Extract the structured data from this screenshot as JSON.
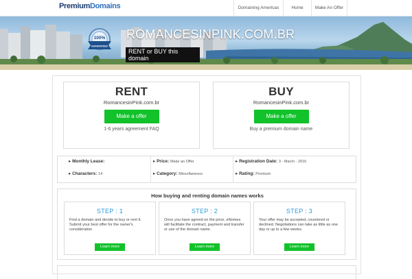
{
  "header": {
    "logo_part1": "Premium",
    "logo_part2": "Domains",
    "nav": [
      "Domaining Americas",
      "Home",
      "Make An Offer"
    ]
  },
  "hero": {
    "badge_top": "100%",
    "badge_ribbon": "GUARANTEED",
    "domain_title": "ROMANCESINPINK.COM.BR",
    "tagline": "RENT or BUY this domain"
  },
  "rent": {
    "heading": "RENT",
    "domain": "RomancesinPink.com.br",
    "button": "Make a offer",
    "sub": "1-6 years agreement FAQ"
  },
  "buy": {
    "heading": "BUY",
    "domain": "RomancesinPink.com.br",
    "button": "Make a offer",
    "sub": "Buy a premium domain name"
  },
  "details": {
    "monthly_lease_label": "Monthly Lease:",
    "monthly_lease_value": "",
    "price_label": "Price:",
    "price_value": "Make an Offer",
    "registration_label": "Registration Date:",
    "registration_value": "3 - March - 2016",
    "characters_label": "Characters:",
    "characters_value": "14",
    "category_label": "Category:",
    "category_value": "Miscellaneous",
    "rating_label": "Rating:",
    "rating_value": "Premium"
  },
  "how": {
    "title": "How buying and renting domain names works",
    "steps": [
      {
        "title": "STEP : 1",
        "text": "Find a domain and decide to buy or rent it. Submit your best offer for the owner's consideration",
        "button": "Learn more"
      },
      {
        "title": "STEP : 2",
        "text": "Once you have agreed on the price, eNomes will facilitate the contract, payment and transfer or use of the domain name.",
        "button": "Learn more"
      },
      {
        "title": "STEP : 3",
        "text": "Your offer may be accepted, countered or declined. Negotiations can take as little as one day or up to a few weeks.",
        "button": "Learn more"
      }
    ]
  },
  "colors": {
    "accent_green": "#11c22a",
    "step_blue": "#2b9bd6",
    "logo_dark": "#1a3a6e",
    "logo_light": "#2b6fc0"
  }
}
